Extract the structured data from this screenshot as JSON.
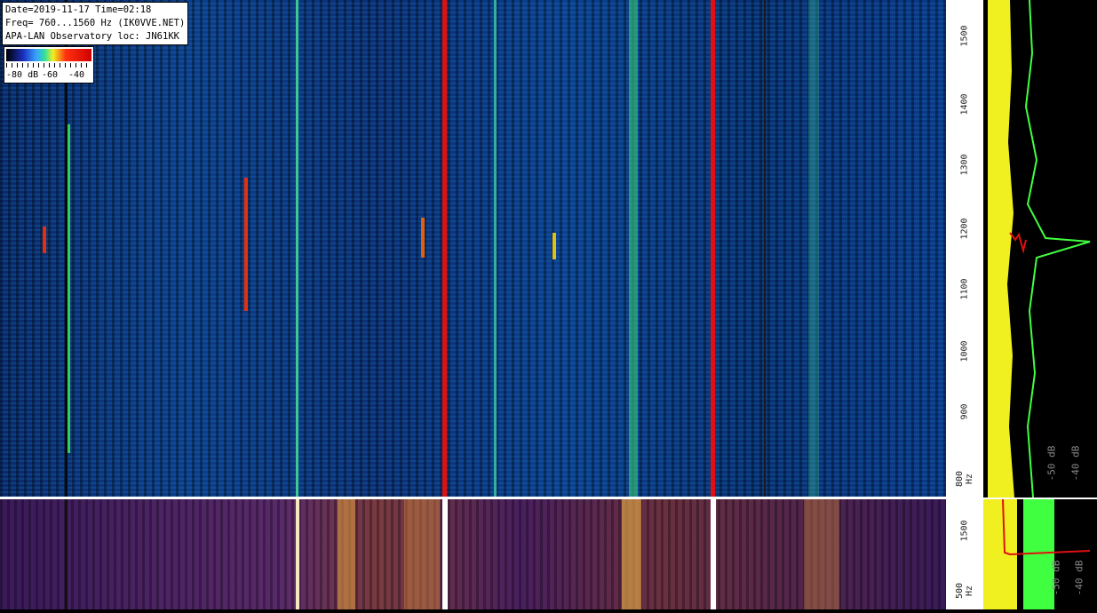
{
  "header": {
    "line1": "Date=2019-11-17 Time=02:18",
    "line2": "Freq= 760...1560 Hz (IK0VVE.NET)",
    "line3": "APA-LAN Observatory loc: JN61KK"
  },
  "colorbar": {
    "labels": [
      "-80 dB",
      "-60",
      "-40"
    ]
  },
  "freq_axis": {
    "main_ticks": [
      "1500",
      "1400",
      "1300",
      "1200",
      "1100",
      "1000",
      "900",
      "800 Hz"
    ],
    "bottom_ticks": [
      "1500",
      "500 Hz"
    ]
  },
  "spectrum": {
    "main_db_labels": [
      "-50 dB",
      "-40 dB"
    ],
    "bottom_db_labels": [
      "-50 dB",
      "-40 dB"
    ]
  },
  "colors": {
    "signal_red": "#e01010",
    "signal_green": "#30e030",
    "trace_yellow": "#f0f020",
    "trace_green": "#40ff40"
  }
}
